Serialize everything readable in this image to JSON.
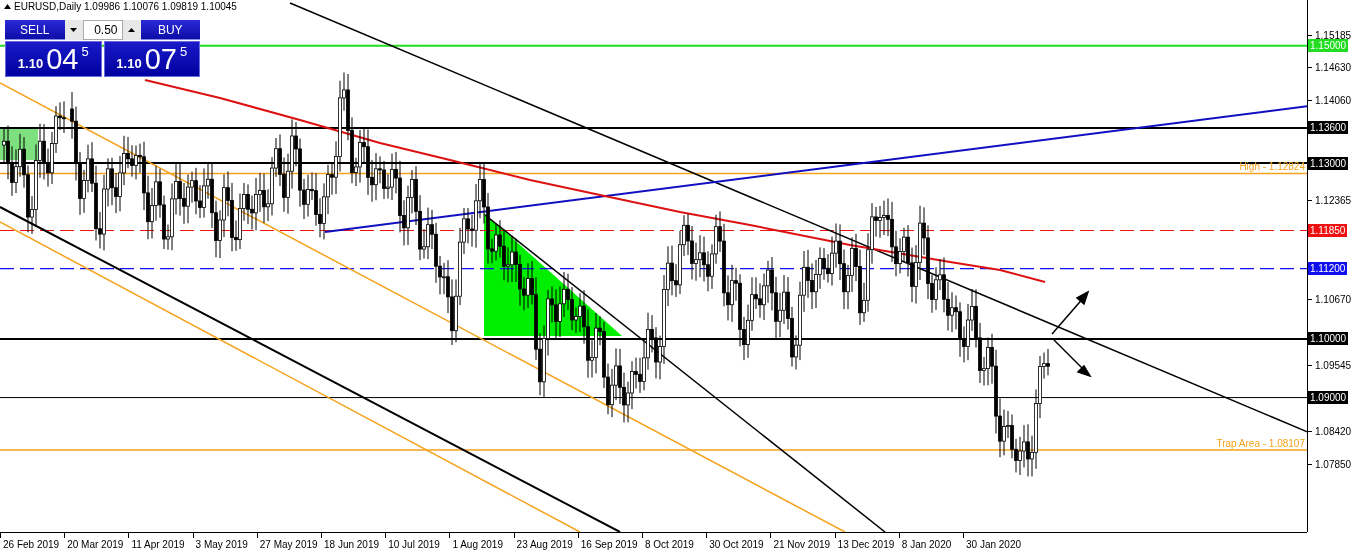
{
  "chart": {
    "header": "EURUSD,Daily  1.09986 1.10076 1.09819 1.10045",
    "trade_panel": {
      "sell_label": "SELL",
      "buy_label": "BUY",
      "lot": "0.50",
      "bid": {
        "prefix": "1.10",
        "big": "04",
        "sup": "5"
      },
      "ask": {
        "prefix": "1.10",
        "big": "07",
        "sup": "5"
      }
    },
    "price_ticks": [
      "1.15185",
      "1.14630",
      "1.14060",
      "1.12365",
      "1.10670",
      "1.09545",
      "1.08420",
      "1.07850"
    ],
    "levels": [
      {
        "label": "1.15000",
        "color": "#22dd22",
        "kind": "solid"
      },
      {
        "label": "1.13600",
        "color": "#000000",
        "kind": "solid"
      },
      {
        "label": "1.13000",
        "color": "#000000",
        "kind": "solid"
      },
      {
        "label": "1.11850",
        "color": "#ee1111",
        "kind": "dashed"
      },
      {
        "label": "1.11200",
        "color": "#1010ee",
        "kind": "dashed"
      },
      {
        "label": "1.10000",
        "color": "#000000",
        "kind": "solid"
      },
      {
        "label": "1.09000",
        "color": "#000000",
        "kind": "thin"
      }
    ],
    "annotations": [
      "High - 1.12824",
      "Trap Area - 1.08107"
    ],
    "dates": [
      "26 Feb 2019",
      "20 Mar 2019",
      "11 Apr 2019",
      "3 May 2019",
      "27 May 2019",
      "18 Jun 2019",
      "10 Jul 2019",
      "1 Aug 2019",
      "23 Aug 2019",
      "16 Sep 2019",
      "8 Oct 2019",
      "30 Oct 2019",
      "21 Nov 2019",
      "13 Dec 2019",
      "8 Jan 2020",
      "30 Jan 2020"
    ]
  }
}
